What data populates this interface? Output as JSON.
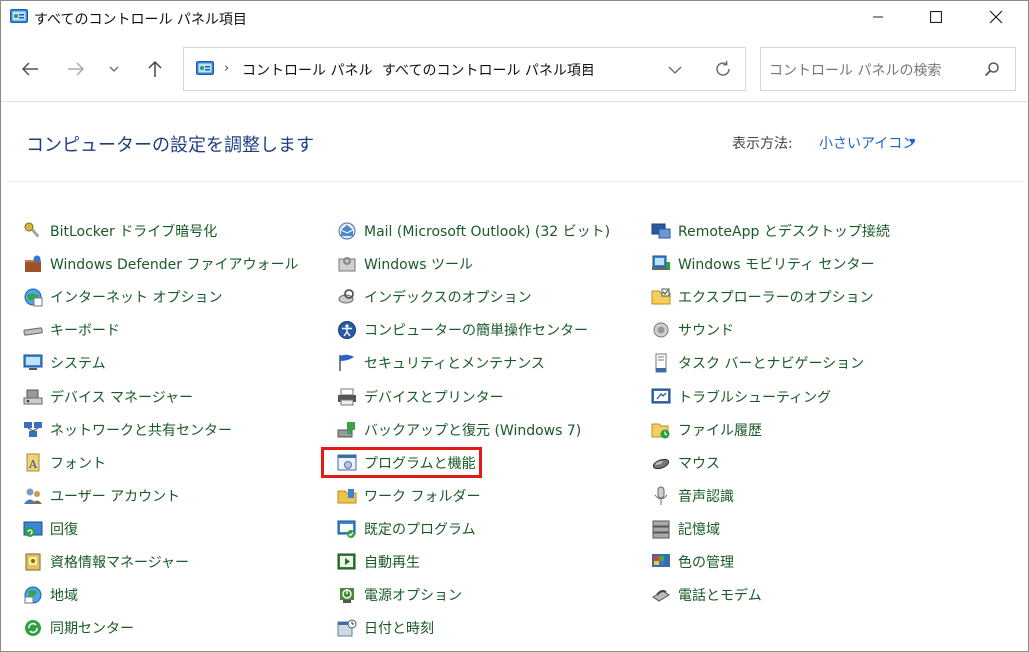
{
  "window": {
    "title": "すべてのコントロール パネル項目",
    "controls": {
      "minimize": "—",
      "maximize": "☐",
      "close": "✕"
    }
  },
  "toolbar": {
    "back_icon": "arrow-left-icon",
    "forward_icon": "arrow-right-icon",
    "recent_icon": "chevron-down-icon",
    "up_icon": "arrow-up-icon",
    "breadcrumb": [
      "コントロール パネル",
      "すべてのコントロール パネル項目"
    ],
    "search_placeholder": "コントロール パネルの検索"
  },
  "header": {
    "title": "コンピューターの設定を調整します",
    "view_label": "表示方法:",
    "view_value": "小さいアイコン"
  },
  "colors": {
    "link": "#1a5a28",
    "heading": "#1e3f84",
    "accent": "#1e66c8",
    "highlight": "#e51a14"
  },
  "columns": [
    {
      "items": [
        {
          "label": "BitLocker ドライブ暗号化",
          "icon": "key-icon"
        },
        {
          "label": "Windows Defender ファイアウォール",
          "icon": "firewall-icon"
        },
        {
          "label": "インターネット オプション",
          "icon": "globe-icon"
        },
        {
          "label": "キーボード",
          "icon": "keyboard-icon"
        },
        {
          "label": "システム",
          "icon": "monitor-icon"
        },
        {
          "label": "デバイス マネージャー",
          "icon": "device-manager-icon"
        },
        {
          "label": "ネットワークと共有センター",
          "icon": "network-icon"
        },
        {
          "label": "フォント",
          "icon": "font-icon"
        },
        {
          "label": "ユーザー アカウント",
          "icon": "users-icon"
        },
        {
          "label": "回復",
          "icon": "recovery-icon"
        },
        {
          "label": "資格情報マネージャー",
          "icon": "credential-icon"
        },
        {
          "label": "地域",
          "icon": "region-icon"
        },
        {
          "label": "同期センター",
          "icon": "sync-icon"
        }
      ]
    },
    {
      "items": [
        {
          "label": "Mail (Microsoft Outlook) (32 ビット)",
          "icon": "mail-icon"
        },
        {
          "label": "Windows ツール",
          "icon": "tools-icon"
        },
        {
          "label": "インデックスのオプション",
          "icon": "index-icon"
        },
        {
          "label": "コンピューターの簡単操作センター",
          "icon": "accessibility-icon"
        },
        {
          "label": "セキュリティとメンテナンス",
          "icon": "flag-icon"
        },
        {
          "label": "デバイスとプリンター",
          "icon": "printer-icon"
        },
        {
          "label": "バックアップと復元 (Windows 7)",
          "icon": "backup-icon"
        },
        {
          "label": "プログラムと機能",
          "icon": "programs-icon"
        },
        {
          "label": "ワーク フォルダー",
          "icon": "work-folder-icon"
        },
        {
          "label": "既定のプログラム",
          "icon": "default-programs-icon"
        },
        {
          "label": "自動再生",
          "icon": "autoplay-icon"
        },
        {
          "label": "電源オプション",
          "icon": "power-icon"
        },
        {
          "label": "日付と時刻",
          "icon": "clock-icon"
        }
      ]
    },
    {
      "items": [
        {
          "label": "RemoteApp とデスクトップ接続",
          "icon": "remoteapp-icon"
        },
        {
          "label": "Windows モビリティ センター",
          "icon": "mobility-icon"
        },
        {
          "label": "エクスプローラーのオプション",
          "icon": "folder-options-icon"
        },
        {
          "label": "サウンド",
          "icon": "speaker-icon"
        },
        {
          "label": "タスク バーとナビゲーション",
          "icon": "taskbar-icon"
        },
        {
          "label": "トラブルシューティング",
          "icon": "troubleshoot-icon"
        },
        {
          "label": "ファイル履歴",
          "icon": "file-history-icon"
        },
        {
          "label": "マウス",
          "icon": "mouse-icon"
        },
        {
          "label": "音声認識",
          "icon": "microphone-icon"
        },
        {
          "label": "記憶域",
          "icon": "storage-icon"
        },
        {
          "label": "色の管理",
          "icon": "color-management-icon"
        },
        {
          "label": "電話とモデム",
          "icon": "phone-modem-icon"
        }
      ]
    }
  ]
}
